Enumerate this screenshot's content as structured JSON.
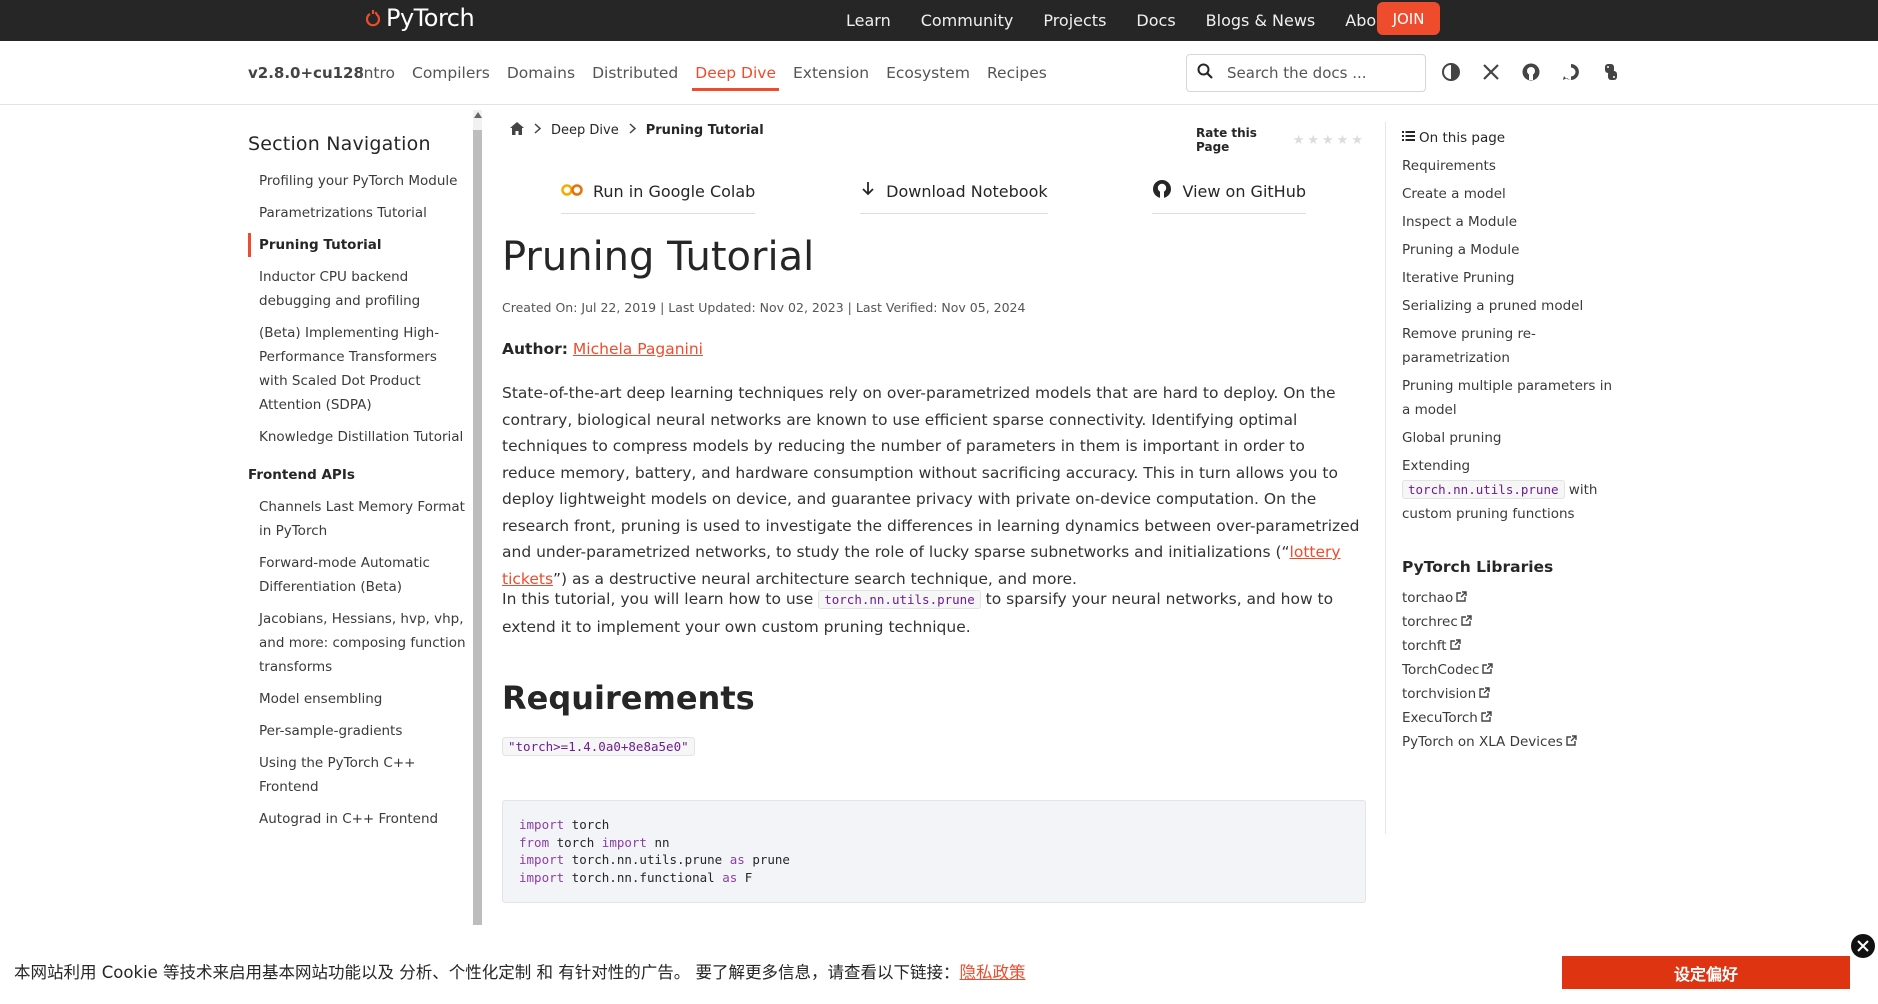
{
  "brand": {
    "name": "PyTorch",
    "accent": "#ee4c2c"
  },
  "topnav": {
    "items": [
      "Learn",
      "Community",
      "Projects",
      "Docs",
      "Blogs & News",
      "About"
    ],
    "join": "JOIN"
  },
  "subheader": {
    "version": "v2.8.0+cu128",
    "tabs": [
      "Intro",
      "Compilers",
      "Domains",
      "Distributed",
      "Deep Dive",
      "Extension",
      "Ecosystem",
      "Recipes"
    ],
    "active_tab": "Deep Dive",
    "search_placeholder": "Search the docs ..."
  },
  "leftnav": {
    "title": "Section Navigation",
    "items1": [
      "Profiling your PyTorch Module",
      "Parametrizations Tutorial",
      "Pruning Tutorial",
      "Inductor CPU backend debugging and profiling",
      "(Beta) Implementing High-Performance Transformers with Scaled Dot Product Attention (SDPA)",
      "Knowledge Distillation Tutorial"
    ],
    "group2": "Frontend APIs",
    "items2": [
      "Channels Last Memory Format in PyTorch",
      "Forward-mode Automatic Differentiation (Beta)",
      "Jacobians, Hessians, hvp, vhp, and more: composing function transforms",
      "Model ensembling",
      "Per-sample-gradients",
      "Using the PyTorch C++ Frontend",
      "Autograd in C++ Frontend"
    ]
  },
  "breadcrumb": {
    "section": "Deep Dive",
    "current": "Pruning Tutorial"
  },
  "rate": {
    "label": "Rate this Page",
    "stars": "★★★★★"
  },
  "actions": {
    "colab": "Run in Google Colab",
    "download": "Download Notebook",
    "github": "View on GitHub"
  },
  "article": {
    "title": "Pruning Tutorial",
    "meta": "Created On: Jul 22, 2019 | Last Updated: Nov 02, 2023 | Last Verified: Nov 05, 2024",
    "author_label": "Author",
    "author_name": "Michela Paganini",
    "p1_a": "State-of-the-art deep learning techniques rely on over-parametrized models that are hard to deploy. On the contrary, biological neural networks are known to use efficient sparse connectivity. Identifying optimal techniques to compress models by reducing the number of parameters in them is important in order to reduce memory, battery, and hardware consumption without sacrificing accuracy. This in turn allows you to deploy lightweight models on device, and guarantee privacy with private on-device computation. On the research front, pruning is used to investigate the differences in learning dynamics between over-parametrized and under-parametrized networks, to study the role of lucky sparse subnetworks and initializations (“",
    "p1_link": "lottery tickets",
    "p1_b": "”) as a destructive neural architecture search technique, and more.",
    "p2_a": "In this tutorial, you will learn how to use ",
    "p2_code": "torch.nn.utils.prune",
    "p2_b": " to sparsify your neural networks, and how to extend it to implement your own custom pruning technique.",
    "requirements_heading": "Requirements",
    "requirement": "\"torch>=1.4.0a0+8e8a5e0\""
  },
  "code": [
    {
      "kw1": "import",
      "t1": " torch",
      "kw2": "",
      "t2": ""
    },
    {
      "kw1": "from",
      "t1": " torch ",
      "kw2": "import",
      "t2": " nn"
    },
    {
      "kw1": "import",
      "t1": " torch.nn.utils.prune ",
      "kw2": "as",
      "t2": " prune"
    },
    {
      "kw1": "import",
      "t1": " torch.nn.functional ",
      "kw2": "as",
      "t2": " F"
    }
  ],
  "toc": {
    "heading": "On this page",
    "items": [
      "Requirements",
      "Create a model",
      "Inspect a Module",
      "Pruning a Module",
      "Iterative Pruning",
      "Serializing a pruned model",
      "Remove pruning re-parametrization",
      "Pruning multiple parameters in a model",
      "Global pruning"
    ],
    "extending_a": "Extending",
    "extending_code": "torch.nn.utils.prune",
    "extending_b": " with custom pruning functions",
    "libs_heading": "PyTorch Libraries",
    "libs": [
      "torchao",
      "torchrec",
      "torchft",
      "TorchCodec",
      "torchvision",
      "ExecuTorch",
      "PyTorch on XLA Devices"
    ]
  },
  "cookie": {
    "text": "本网站利用 Cookie 等技术来启用基本网站功能以及 分析、个性化定制 和 有针对性的广告。 要了解更多信息，请查看以下链接：",
    "link": "隐私政策",
    "button": "设定偏好"
  }
}
